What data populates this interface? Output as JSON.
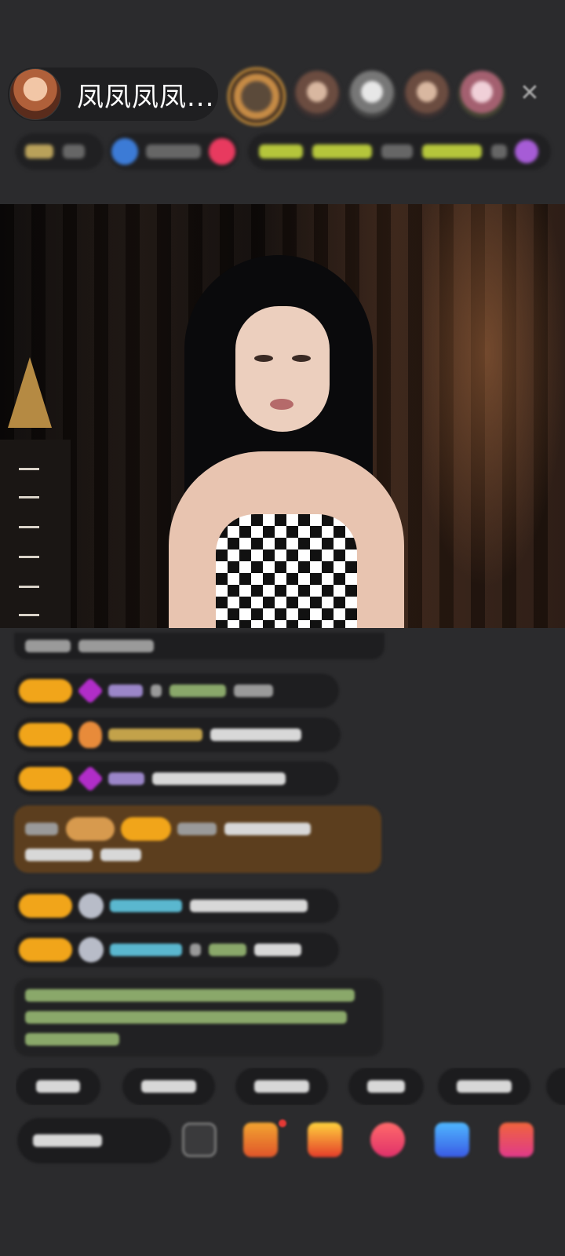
{
  "header": {
    "host_name": "凤凤凤凤...",
    "host_avatar_icon": "host-avatar",
    "viewer_avatars": [
      "viewer-avatar-1",
      "viewer-avatar-2",
      "viewer-avatar-3",
      "viewer-avatar-4",
      "viewer-avatar-5"
    ],
    "close_icon": "close-icon",
    "close_glyph": "✕"
  },
  "colors": {
    "background": "#2b2b2d",
    "badge_gold": "#f1a51a",
    "highlight_message": "#6e4619",
    "notice_text": "#8aa86a"
  },
  "video": {
    "subject": "live-stream-video"
  },
  "chat": {
    "note": ""
  },
  "bottom_bar": {
    "icons": [
      "face-icon",
      "gift-box-icon",
      "coin-box-icon",
      "heart-icon",
      "game-icon",
      "more-apps-icon"
    ]
  }
}
